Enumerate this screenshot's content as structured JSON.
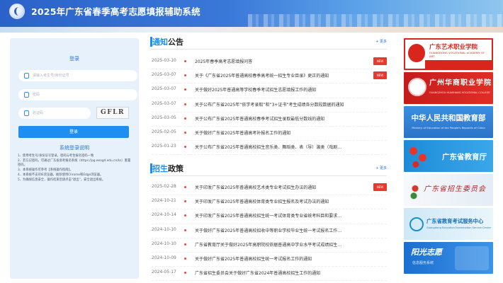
{
  "header": {
    "title": "2025年广东省春季高考志愿填报辅助系统"
  },
  "login": {
    "title": "登录",
    "id_placeholder": "请输入考生号/身份证号",
    "password_placeholder": "密码",
    "captcha_placeholder": "验证码",
    "captcha_text": "GFLR",
    "button_label": "登录",
    "notes_title": "系统登录说明",
    "notes": [
      "1、使用考生号/身份证号登录，密码与考生报名密码一致",
      "2、若忘记密码，可通过广东省高考报名系统（https://pg.eeagd.edu.cn/ks）重置密码。",
      "3、本系统操作可参考【系统操作指南】。",
      "4、本系统不支持IE浏览器，推荐使用Chrome和Edge浏览器。",
      "5、为确保信息安全，操作结束后请点击“退出”，安全退出系统。"
    ]
  },
  "notice": {
    "title_accent": "通知",
    "title_rest": "公告",
    "more": "+ 更多",
    "items": [
      {
        "date": "2025-03-10",
        "text": "2025年春季高考志愿填报问答",
        "new": "NEW"
      },
      {
        "date": "2025-03-07",
        "text": "关于《广东省2025年普通高校春季高考统一招生专业目录》更正的通知",
        "new": "NEW"
      },
      {
        "date": "2025-03-07",
        "text": "关于做好2025年普通高等学校春季考试招生志愿填报工作的通知",
        "new": ""
      },
      {
        "date": "2025-03-07",
        "text": "关于公布广东省2025年“依学考录取”和“3+证书”考生成绩各分数段数据的通知",
        "new": ""
      },
      {
        "date": "2025-03-05",
        "text": "关于公布广东省2025年普通高校春季考试招生录取最低分数线的通知",
        "new": ""
      },
      {
        "date": "2025-02-05",
        "text": "关于做好广东省2025年普通高考补报名工作的通知",
        "new": ""
      },
      {
        "date": "2025-01-23",
        "text": "关于公布广东省2025年普通高校招生音乐类、舞蹈类、表（导）演类（戏剧…",
        "new": ""
      }
    ]
  },
  "policy": {
    "title_accent": "招生",
    "title_rest": "政策",
    "more": "+ 更多",
    "items": [
      {
        "date": "2025-02-28",
        "text": "关于印发广东省2025年普通高校艺术类专业考试招生办法的通知",
        "new": "NEW"
      },
      {
        "date": "2024-10-21",
        "text": "关于印发广东省2025年普通高校体育类专业招生报名及考试办法的通知",
        "new": ""
      },
      {
        "date": "2024-10-14",
        "text": "关于印发广东省2025年普通高校招生统一考试体育类专业省统考科目和要求…",
        "new": ""
      },
      {
        "date": "2024-10-10",
        "text": "关于做好广东省2025年普通高校招收中等职业学校毕业生统一考试报名工作…",
        "new": ""
      },
      {
        "date": "2024-10-10",
        "text": "广东省教育厅关于做好2025年高职院校依据普通高中学业水平考试成绩招生…",
        "new": ""
      },
      {
        "date": "2024-10-09",
        "text": "关于做好广东省2025年普通高校招生统一考试报名工作的通知",
        "new": ""
      },
      {
        "date": "2024-05-17",
        "text": "广东省招生委员会关于做好广东省2024年普通高校招生工作的通知",
        "new": ""
      }
    ]
  },
  "banners": {
    "b1_title": "广东艺术职业学院",
    "b1_sub": "GUANGDONG VOCATIONAL ACADEMY OF ART",
    "b2_title": "广州华商职业学院",
    "b2_sub": "GUANGZHOU HUASHANG VOCATIONAL COLLEGE",
    "b3_title": "中华人民共和国教育部",
    "b3_sub": "Ministry of Education of the People's Republic of China",
    "b4_title": "广东省教育厅",
    "b5_title": "广东省招生委员会",
    "b6_title": "广东省教育考试服务中心",
    "b6_sub": "Guangdong Education Examination Service Center",
    "b7_title": "阳光志愿",
    "b7_sub": "信息服务系统"
  },
  "colors": {
    "primary": "#1f8ef1",
    "new_badge": "#e8392f",
    "header_blue": "#2b62c9"
  }
}
